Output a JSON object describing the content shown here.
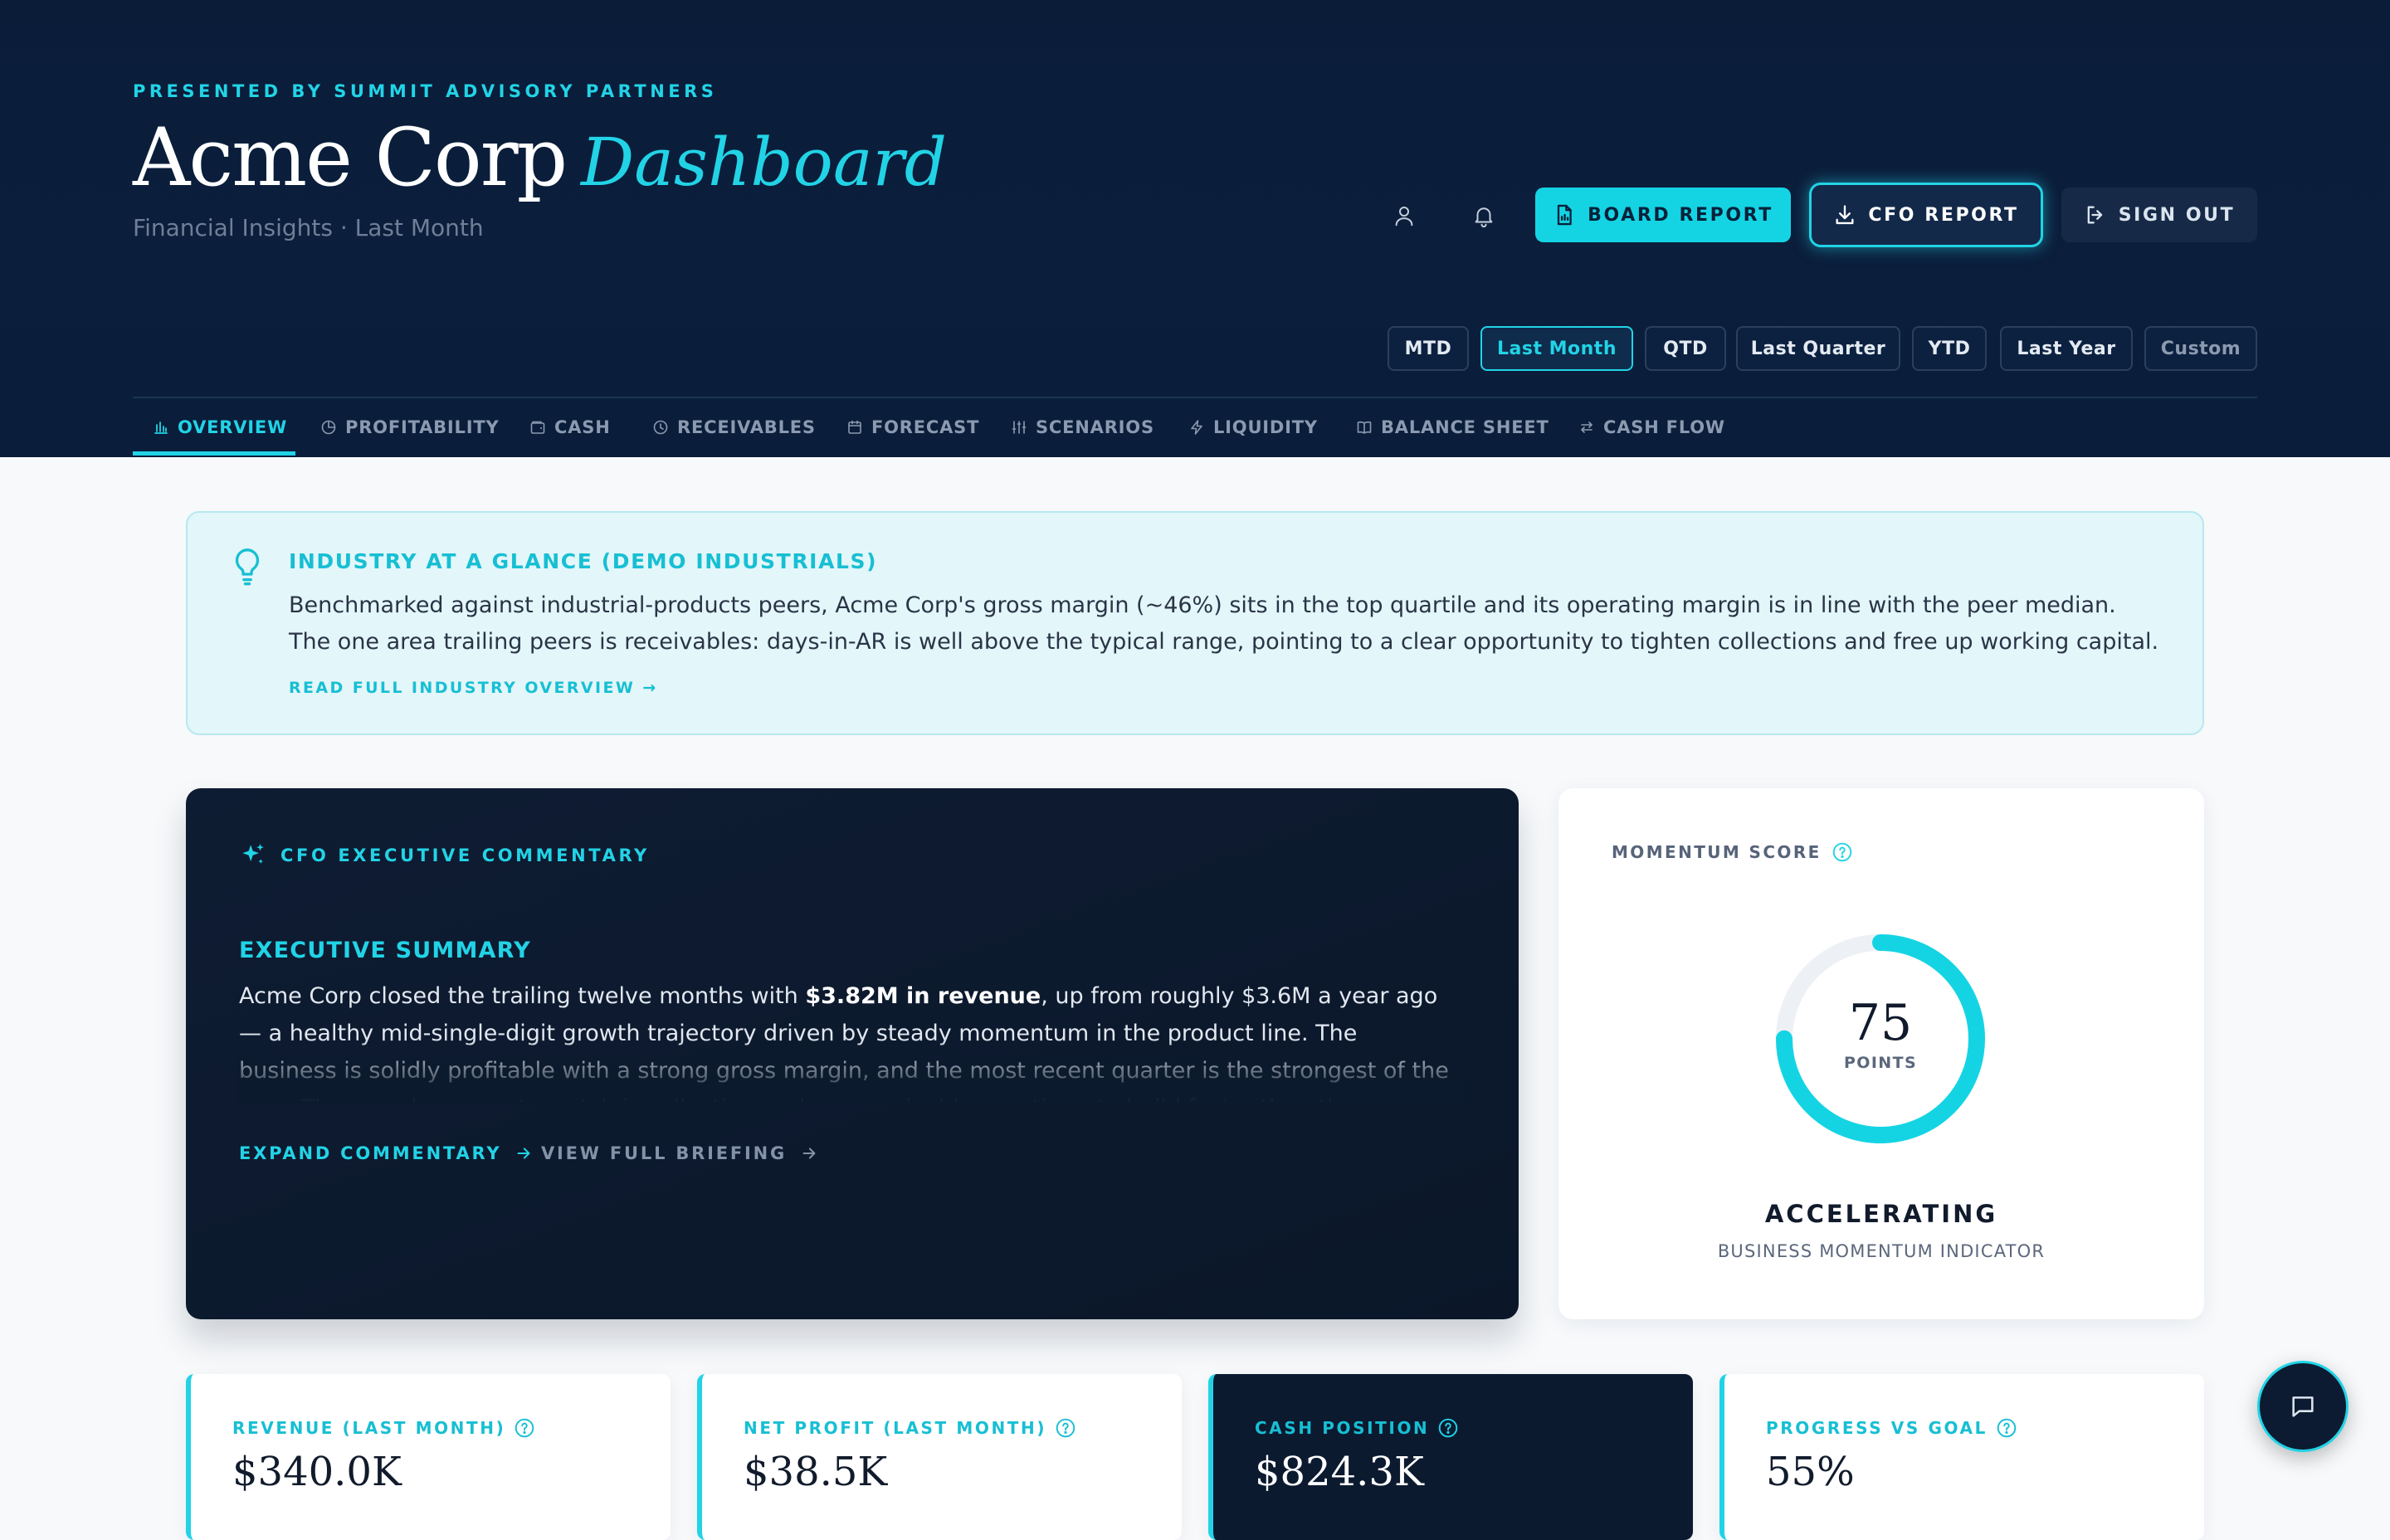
{
  "header": {
    "eyebrow": "PRESENTED BY SUMMIT ADVISORY PARTNERS",
    "company": "Acme Corp",
    "title_accent": "Dashboard",
    "subtitle": "Financial Insights · Last Month",
    "actions": {
      "board_report": "BOARD REPORT",
      "cfo_report": "CFO REPORT",
      "sign_out": "SIGN OUT"
    },
    "periods": [
      "MTD",
      "Last Month",
      "QTD",
      "Last Quarter",
      "YTD",
      "Last Year",
      "Custom"
    ],
    "active_period": "Last Month"
  },
  "nav": {
    "tabs": [
      "OVERVIEW",
      "PROFITABILITY",
      "CASH",
      "RECEIVABLES",
      "FORECAST",
      "SCENARIOS",
      "LIQUIDITY",
      "BALANCE SHEET",
      "CASH FLOW"
    ],
    "active": "OVERVIEW"
  },
  "industry": {
    "title": "INDUSTRY AT A GLANCE (DEMO INDUSTRIALS)",
    "body": "Benchmarked against industrial-products peers, Acme Corp's gross margin (~46%) sits in the top quartile and its operating margin is in line with the peer median. The one area trailing peers is receivables: days-in-AR is well above the typical range, pointing to a clear opportunity to tighten collections and free up working capital.",
    "link": "READ FULL INDUSTRY OVERVIEW →"
  },
  "commentary": {
    "eyebrow": "CFO EXECUTIVE COMMENTARY",
    "section_title": "EXECUTIVE SUMMARY",
    "body_prefix": "Acme Corp closed the trailing twelve months with ",
    "body_emphasis": "$3.82M in revenue",
    "body_suffix": ", up from roughly $3.6M a year ago — a healthy mid-single-digit growth trajectory driven by steady momentum in the product line. The business is solidly profitable with a strong gross margin, and the most recent quarter is the strongest of the year. The one clear area to watch is collections, where receivables continue to build faster than the business is growing.",
    "expand_label": "EXPAND COMMENTARY",
    "briefing_label": "VIEW FULL BRIEFING"
  },
  "momentum": {
    "label": "MOMENTUM SCORE",
    "score": 75,
    "max": 100,
    "unit": "POINTS",
    "status": "ACCELERATING",
    "subtitle": "BUSINESS MOMENTUM INDICATOR",
    "color": "#14d4e4"
  },
  "kpis": [
    {
      "label": "REVENUE (LAST MONTH)",
      "value": "$340.0K",
      "dark": false
    },
    {
      "label": "NET PROFIT (LAST MONTH)",
      "value": "$38.5K",
      "dark": false
    },
    {
      "label": "CASH POSITION",
      "value": "$824.3K",
      "dark": true
    },
    {
      "label": "PROGRESS VS GOAL",
      "value": "55%",
      "dark": false
    }
  ],
  "colors": {
    "accent": "#22d3e6",
    "header_bg": "#0b1f3d",
    "page_bg": "#f7f9fb"
  }
}
